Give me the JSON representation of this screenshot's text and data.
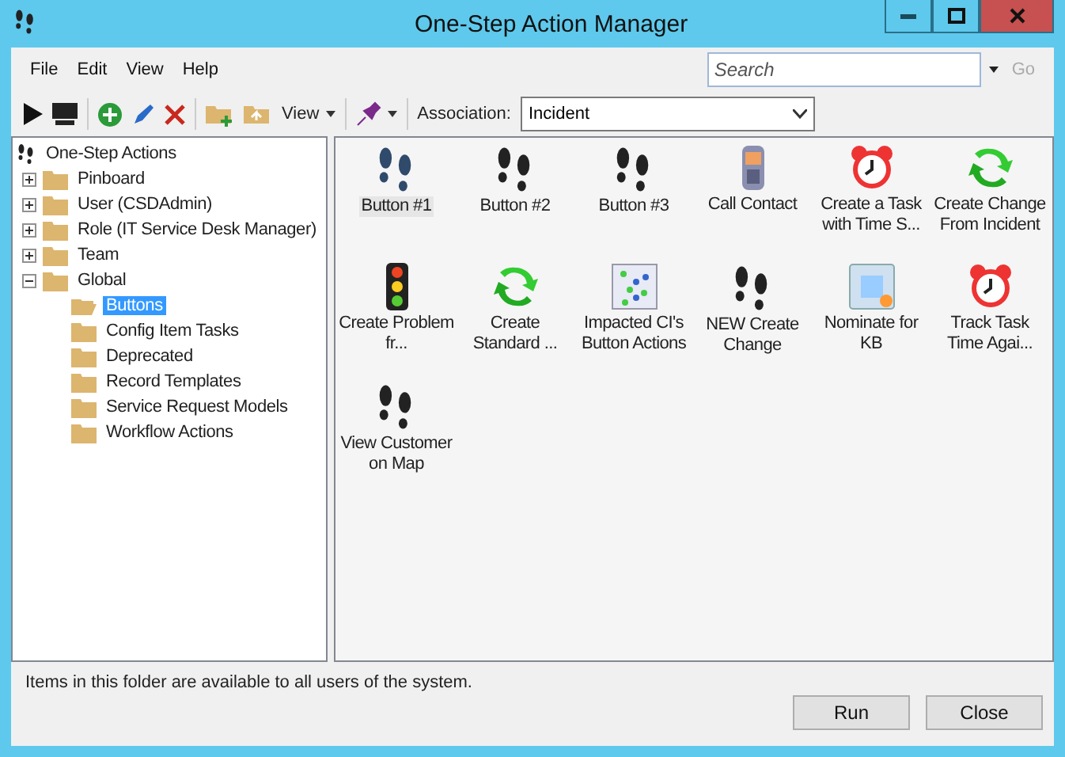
{
  "window": {
    "title": "One-Step Action Manager"
  },
  "menu": [
    "File",
    "Edit",
    "View",
    "Help"
  ],
  "search": {
    "placeholder": "Search",
    "go": "Go"
  },
  "toolbar": {
    "view_label": "View",
    "association_label": "Association:",
    "association_value": "Incident"
  },
  "tree": {
    "label": "One-Step Actions",
    "children": [
      {
        "label": "Pinboard",
        "expanded": false,
        "selected": false
      },
      {
        "label": "User (CSDAdmin)",
        "expanded": false,
        "selected": false
      },
      {
        "label": "Role (IT Service Desk Manager)",
        "expanded": false,
        "selected": false
      },
      {
        "label": "Team",
        "expanded": false,
        "selected": false
      },
      {
        "label": "Global",
        "expanded": true,
        "selected": false,
        "children": [
          {
            "label": "Buttons",
            "selected": true
          },
          {
            "label": "Config Item Tasks",
            "selected": false
          },
          {
            "label": "Deprecated",
            "selected": false
          },
          {
            "label": "Record Templates",
            "selected": false
          },
          {
            "label": "Service Request Models",
            "selected": false
          },
          {
            "label": "Workflow Actions",
            "selected": false
          }
        ]
      }
    ]
  },
  "actions": [
    {
      "label": "Button #1",
      "kind": "footprints",
      "selected": true
    },
    {
      "label": "Button #2",
      "kind": "footprints",
      "selected": false
    },
    {
      "label": "Button #3",
      "kind": "footprints",
      "selected": false
    },
    {
      "label": "Call Contact",
      "kind": "phone",
      "selected": false
    },
    {
      "label": "Create a Task with Time S...",
      "kind": "alarm",
      "selected": false
    },
    {
      "label": "Create Change From Incident",
      "kind": "recycle",
      "selected": false
    },
    {
      "label": "Create Problem fr...",
      "kind": "traffic",
      "selected": false
    },
    {
      "label": "Create Standard ...",
      "kind": "recycle",
      "selected": false
    },
    {
      "label": "Impacted CI's Button Actions",
      "kind": "grid",
      "selected": false
    },
    {
      "label": "NEW Create Change",
      "kind": "footprints",
      "selected": false
    },
    {
      "label": "Nominate for KB",
      "kind": "kb",
      "selected": false
    },
    {
      "label": "Track Task Time Agai...",
      "kind": "alarm",
      "selected": false
    },
    {
      "label": "View Customer on Map",
      "kind": "footprints",
      "selected": false
    }
  ],
  "status": "Items in this folder are available to all users of the system.",
  "buttons": [
    "Run",
    "Close"
  ]
}
